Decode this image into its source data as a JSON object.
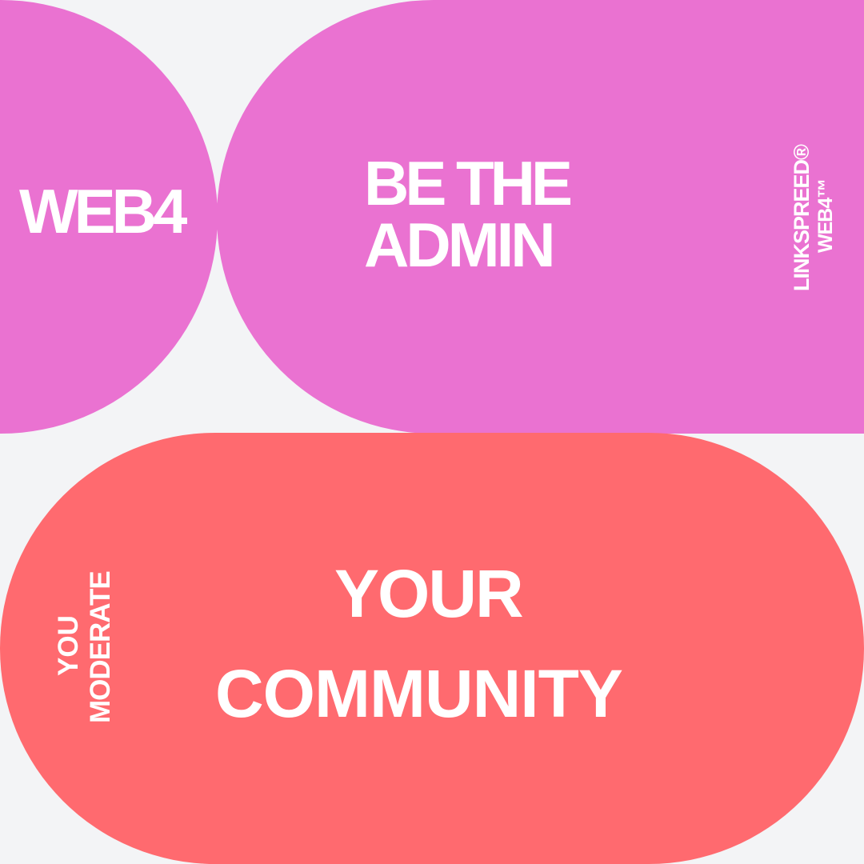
{
  "colors": {
    "background": "#f3f4f6",
    "pink": "#ea72d1",
    "coral": "#ff6a6f",
    "text": "#ffffff"
  },
  "top": {
    "left_label": "WEB4",
    "headline_line_1": "BE THE",
    "headline_line_2": "ADMIN",
    "brand_line_1": "LINKSPREED®",
    "brand_line_2": "WEB4™"
  },
  "bottom": {
    "side_line_1": "YOU",
    "side_line_2": "MODERATE",
    "headline_line_1": "YOUR",
    "headline_line_2": "COMMUNITY"
  }
}
